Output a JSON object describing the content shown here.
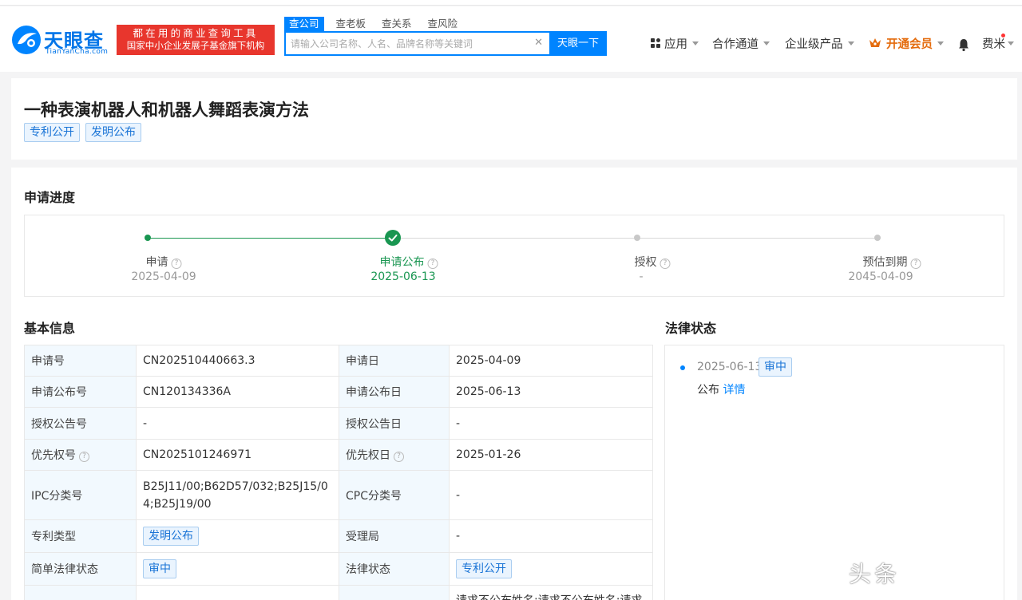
{
  "brand": {
    "name_zh": "天眼查",
    "name_en": "TianYanCha.com",
    "slogan_line1": "都在用的商业查询工具",
    "slogan_line2": "国家中小企业发展子基金旗下机构",
    "accent": "#0084ff",
    "slogan_bg": "#e8362d"
  },
  "search": {
    "tabs": [
      "查公司",
      "查老板",
      "查关系",
      "查风险"
    ],
    "active_tab": "查公司",
    "placeholder": "请输入公司名称、人名、品牌名称等关键词",
    "clear_icon": "close-icon",
    "button": "天眼一下"
  },
  "nav": {
    "apps": "应用",
    "partner": "合作通道",
    "enterprise": "企业级产品",
    "vip": "开通会员",
    "user": "费米"
  },
  "patent": {
    "title": "一种表演机器人和机器人舞蹈表演方法",
    "tags": [
      "专利公开",
      "发明公布"
    ]
  },
  "progress": {
    "section_title": "申请进度",
    "steps": [
      {
        "label": "申请",
        "date": "2025-04-09",
        "state": "done"
      },
      {
        "label": "申请公布",
        "date": "2025-06-13",
        "state": "current"
      },
      {
        "label": "授权",
        "date": "-",
        "state": "pending"
      },
      {
        "label": "预估到期",
        "date": "2045-04-09",
        "state": "pending"
      }
    ],
    "done_color": "#199651",
    "pending_color": "#cccccc"
  },
  "basic": {
    "section_title": "基本信息",
    "rows": [
      {
        "k1": "申请号",
        "v1": "CN202510440663.3",
        "k2": "申请日",
        "v2": "2025-04-09"
      },
      {
        "k1": "申请公布号",
        "v1": "CN120134336A",
        "k2": "申请公布日",
        "v2": "2025-06-13"
      },
      {
        "k1": "授权公告号",
        "v1": "-",
        "k2": "授权公告日",
        "v2": "-"
      },
      {
        "k1": "优先权号",
        "v1": "CN2025101246971",
        "k2": "优先权日",
        "v2": "2025-01-26"
      },
      {
        "k1": "IPC分类号",
        "v1": "B25J11/00;B62D57/032;B25J15/04;B25J19/00",
        "k2": "CPC分类号",
        "v2": "-"
      },
      {
        "k1": "专利类型",
        "v1": "发明公布",
        "k2": "受理局",
        "v2": "-"
      },
      {
        "k1": "简单法律状态",
        "v1": "审中",
        "k2": "法律状态",
        "v2": "专利公开"
      },
      {
        "k1": "",
        "v1": "",
        "k2": "",
        "v2": "请求不公布姓名;请求不公布姓名;请求"
      }
    ]
  },
  "legal": {
    "section_title": "法律状态",
    "entries": [
      {
        "date": "2025-06-13",
        "tag": "审中",
        "text": "公布",
        "link": "详情"
      }
    ]
  },
  "watermark": "头条"
}
